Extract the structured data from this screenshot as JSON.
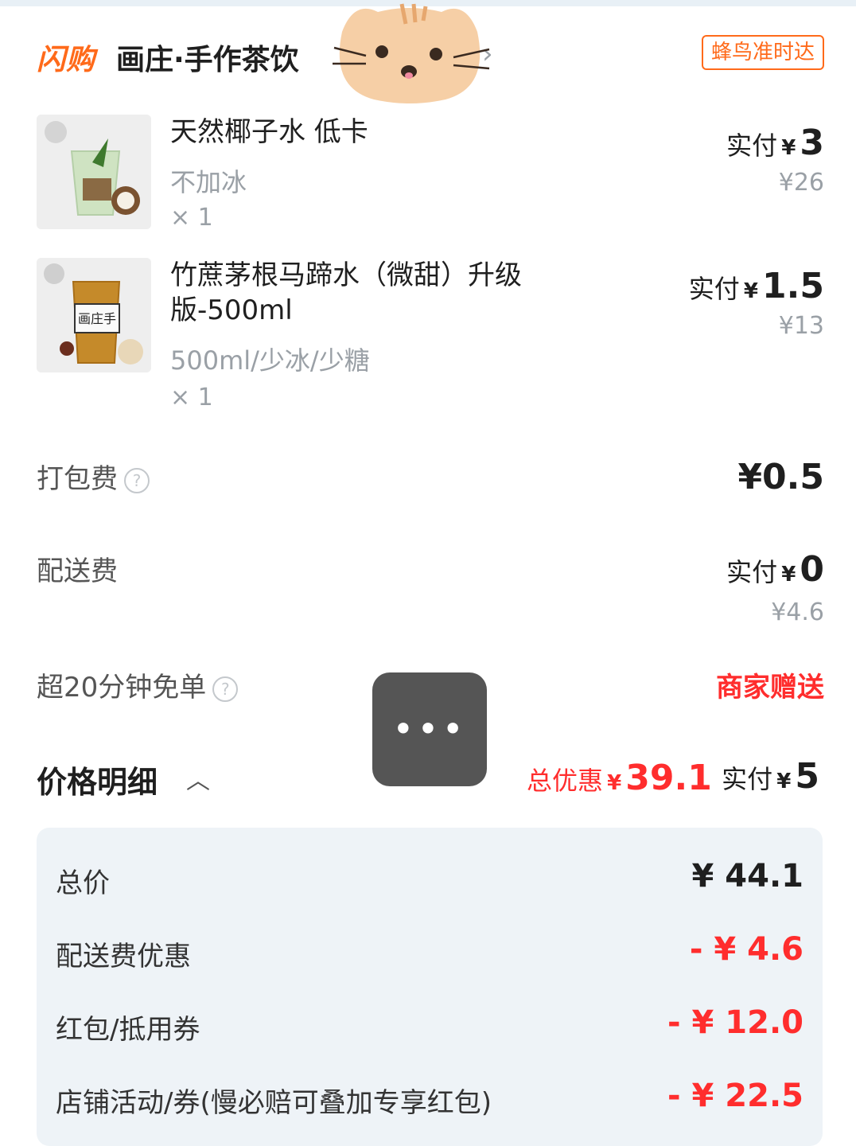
{
  "header": {
    "brand": "闪购",
    "shop_name": "画庄·手作茶饮",
    "delivery_badge": "蜂鸟准时达"
  },
  "items": [
    {
      "name": "天然椰子水 低卡",
      "spec": "不加冰",
      "qty": "× 1",
      "paid_label": "实付",
      "currency": "¥",
      "paid_amount": "3",
      "original_price": "¥26"
    },
    {
      "name": "竹蔗茅根马蹄水（微甜）升级版-500ml",
      "spec": "500ml/少冰/少糖",
      "qty": "× 1",
      "paid_label": "实付",
      "currency": "¥",
      "paid_amount": "1.5",
      "original_price": "¥13"
    }
  ],
  "fees": {
    "packing_label": "打包费",
    "packing_value": "¥0.5",
    "delivery_label": "配送费",
    "delivery_paid_label": "实付",
    "delivery_currency": "¥",
    "delivery_paid_amount": "0",
    "delivery_original": "¥4.6",
    "late_free_label": "超20分钟免单",
    "late_free_value": "商家赠送"
  },
  "price_detail": {
    "title": "价格明细",
    "discount_label": "总优惠",
    "discount_currency": "¥",
    "discount_amount": "39.1",
    "paid_label": "实付",
    "paid_currency": "¥",
    "paid_amount": "5",
    "rows": [
      {
        "label": "总价",
        "value": "¥ 44.1"
      },
      {
        "label": "配送费优惠",
        "value": "- ¥ 4.6"
      },
      {
        "label": "红包/抵用券",
        "value": "- ¥ 12.0"
      },
      {
        "label": "店铺活动/券(慢必赔可叠加专享红包)",
        "value": "- ¥ 22.5"
      }
    ]
  },
  "colors": {
    "brand_orange": "#ff6a1a",
    "accent_red": "#ff2d2d",
    "muted_gray": "#9aa0a6",
    "panel_bg": "#eef3f7"
  },
  "icons": {
    "help": "question-circle-icon",
    "shop_arrow": "chevron-right-icon",
    "detail_toggle": "chevron-up-icon",
    "overlay": "more-dots-icon"
  }
}
